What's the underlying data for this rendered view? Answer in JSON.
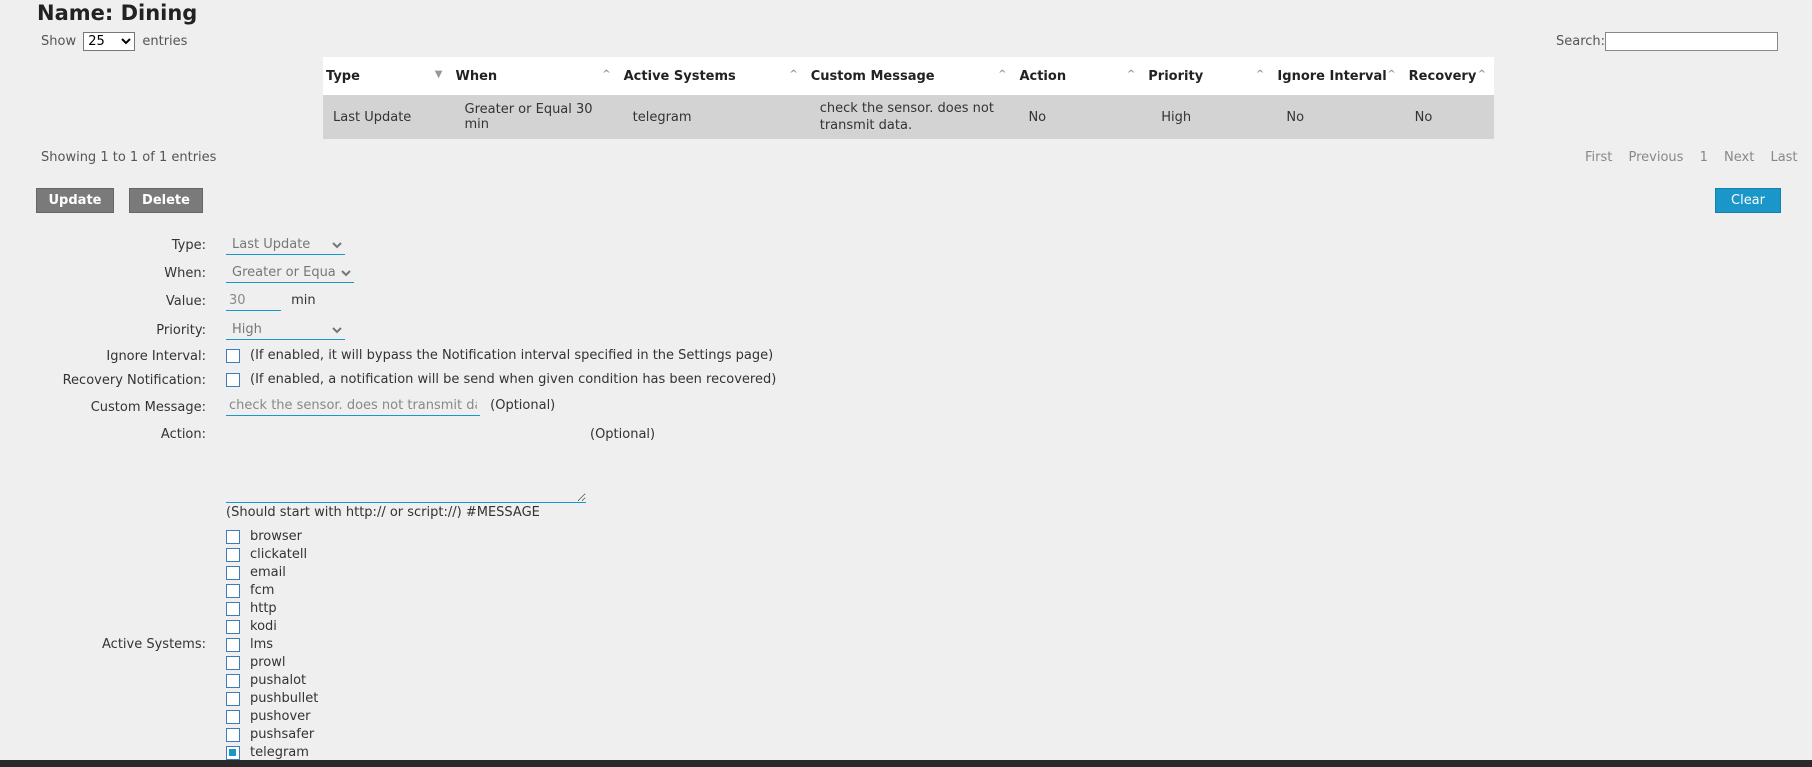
{
  "page": {
    "title": "Name: Dining"
  },
  "table_controls": {
    "show_label": "Show",
    "entries_value": "25",
    "entries_label": "entries",
    "search_label": "Search:",
    "search_value": ""
  },
  "table": {
    "columns": [
      "Type",
      "When",
      "Active Systems",
      "Custom Message",
      "Action",
      "Priority",
      "Ignore Interval",
      "Recovery"
    ],
    "rows": [
      [
        "Last Update",
        "Greater or Equal 30 min",
        "telegram",
        "check the sensor. does not transmit data.",
        "No",
        "High",
        "No",
        "No"
      ]
    ]
  },
  "table_info": "Showing 1 to 1 of 1 entries",
  "pagination": {
    "first": "First",
    "previous": "Previous",
    "page": "1",
    "next": "Next",
    "last": "Last"
  },
  "buttons": {
    "update": "Update",
    "delete": "Delete",
    "clear": "Clear"
  },
  "form": {
    "type_label": "Type:",
    "type_value": "Last Update",
    "when_label": "When:",
    "when_value": "Greater or Equal",
    "value_label": "Value:",
    "value_value": "30",
    "value_unit": "min",
    "priority_label": "Priority:",
    "priority_value": "High",
    "ignore_label": "Ignore Interval:",
    "ignore_hint": "(If enabled, it will bypass the Notification interval specified in the Settings page)",
    "recovery_label": "Recovery Notification:",
    "recovery_hint": "(If enabled, a notification will be send when given condition has been recovered)",
    "message_label": "Custom Message:",
    "message_value": "check the sensor. does not transmit data.",
    "message_optional": "(Optional)",
    "action_label": "Action:",
    "action_optional": "(Optional)",
    "action_hint": "(Should start with http:// or script://) #MESSAGE",
    "systems_label": "Active Systems:",
    "systems": [
      {
        "name": "browser",
        "checked": false
      },
      {
        "name": "clickatell",
        "checked": false
      },
      {
        "name": "email",
        "checked": false
      },
      {
        "name": "fcm",
        "checked": false
      },
      {
        "name": "http",
        "checked": false
      },
      {
        "name": "kodi",
        "checked": false
      },
      {
        "name": "lms",
        "checked": false
      },
      {
        "name": "prowl",
        "checked": false
      },
      {
        "name": "pushalot",
        "checked": false
      },
      {
        "name": "pushbullet",
        "checked": false
      },
      {
        "name": "pushover",
        "checked": false
      },
      {
        "name": "pushsafer",
        "checked": false
      },
      {
        "name": "telegram",
        "checked": true
      }
    ]
  },
  "colors": {
    "accent": "#1a96c8",
    "button_gray": "#7a7a7a",
    "row_bg": "#d3d3d3"
  }
}
